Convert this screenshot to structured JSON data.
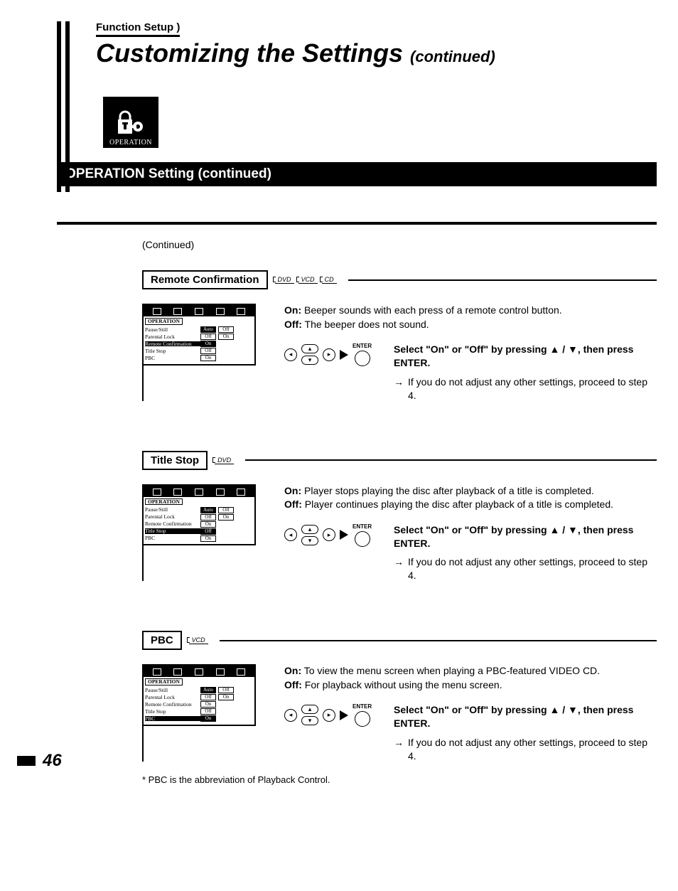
{
  "breadcrumb": "Function Setup",
  "title_main": "Customizing the Settings",
  "title_cont": "(continued)",
  "op_icon_label": "OPERATION",
  "band_heading": "OPERATION Setting (continued)",
  "continued_label": "(Continued)",
  "disc_labels": {
    "dvd": "DVD",
    "vcd": "VCD",
    "cd": "CD"
  },
  "enter_label": "ENTER",
  "osd_tab_label": "OPERATION",
  "osd_rows": {
    "pause_still": {
      "k": "Pause/Still",
      "v1": "Auto",
      "v2": "Off"
    },
    "parental_lock": {
      "k": "Parental Lock",
      "v1": "Off",
      "v2": "On"
    },
    "remote_conf": {
      "k": "Remote Confirmation",
      "v1": "On",
      "v2": ""
    },
    "title_stop": {
      "k": "Title Stop",
      "v1": "Off",
      "v2": ""
    },
    "pbc": {
      "k": "PBC",
      "v1": "On",
      "v2": ""
    }
  },
  "sections": {
    "remote": {
      "title": "Remote Confirmation",
      "on_label": "On:",
      "on_text": "Beeper sounds with each press of a remote control button.",
      "off_label": "Off:",
      "off_text": "The beeper does not sound.",
      "instr_bold": "Select \"On\" or \"Off\" by pressing ▲ / ▼, then press ENTER.",
      "note_text": "If you do not adjust any other settings, proceed to step 4."
    },
    "title_stop": {
      "title": "Title Stop",
      "on_label": "On:",
      "on_text": "Player stops playing the disc after playback of a title is completed.",
      "off_label": "Off:",
      "off_text": "Player continues playing the disc after playback of a title is completed.",
      "instr_bold": "Select \"On\" or \"Off\" by pressing ▲ / ▼, then press ENTER.",
      "note_text": "If you do not adjust any other settings, proceed to step 4."
    },
    "pbc": {
      "title": "PBC",
      "on_label": "On:",
      "on_text": "To view the menu screen when playing a PBC-featured VIDEO CD.",
      "off_label": "Off:",
      "off_text": "For playback without using the menu screen.",
      "instr_bold": "Select \"On\" or \"Off\" by pressing ▲ / ▼, then press ENTER.",
      "note_text": "If you do not adjust any other settings, proceed to step 4.",
      "footnote": "* PBC is the abbreviation of Playback Control."
    }
  },
  "page_number": "46"
}
